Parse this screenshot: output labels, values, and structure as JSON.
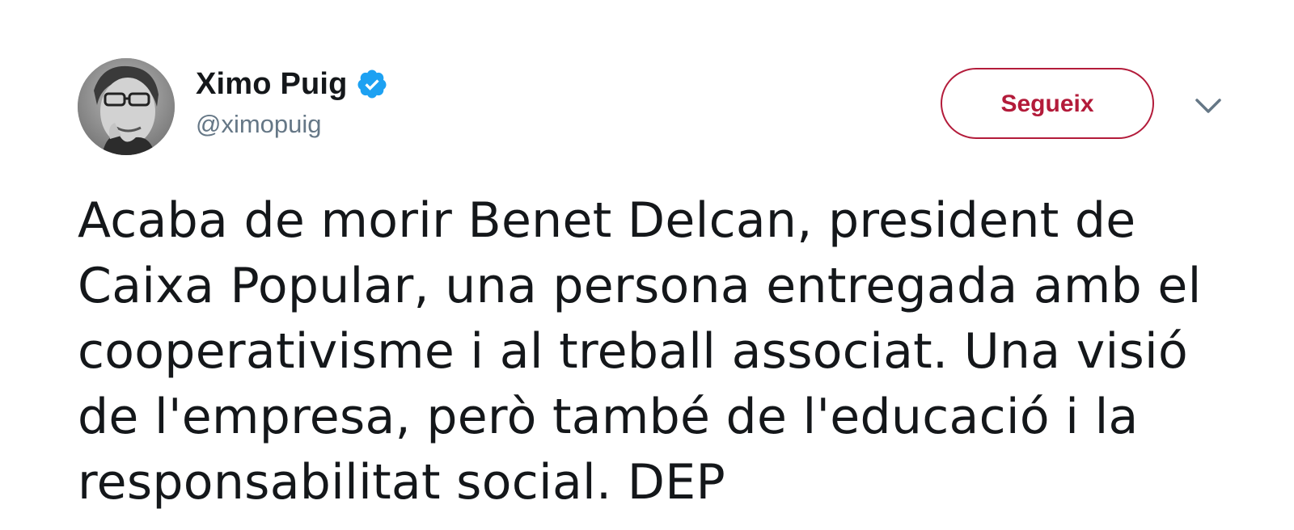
{
  "tweet": {
    "author": {
      "display_name": "Ximo Puig",
      "handle": "@ximopuig",
      "verified": true,
      "avatar_icon": "profile-photo"
    },
    "follow_button_label": "Segueix",
    "menu_icon": "chevron-down-icon",
    "text_lines": [
      "Acaba de morir Benet Delcan, president de",
      "Caixa Popular, una persona entregada amb el",
      "cooperativisme i al treball associat. Una visió",
      "de l'empresa, però també de l'educació i la",
      "responsabilitat social. DEP"
    ]
  },
  "colors": {
    "accent": "#b31b3a",
    "verified_badge": "#1da1f2",
    "handle_gray": "#657786",
    "text": "#14171a"
  }
}
